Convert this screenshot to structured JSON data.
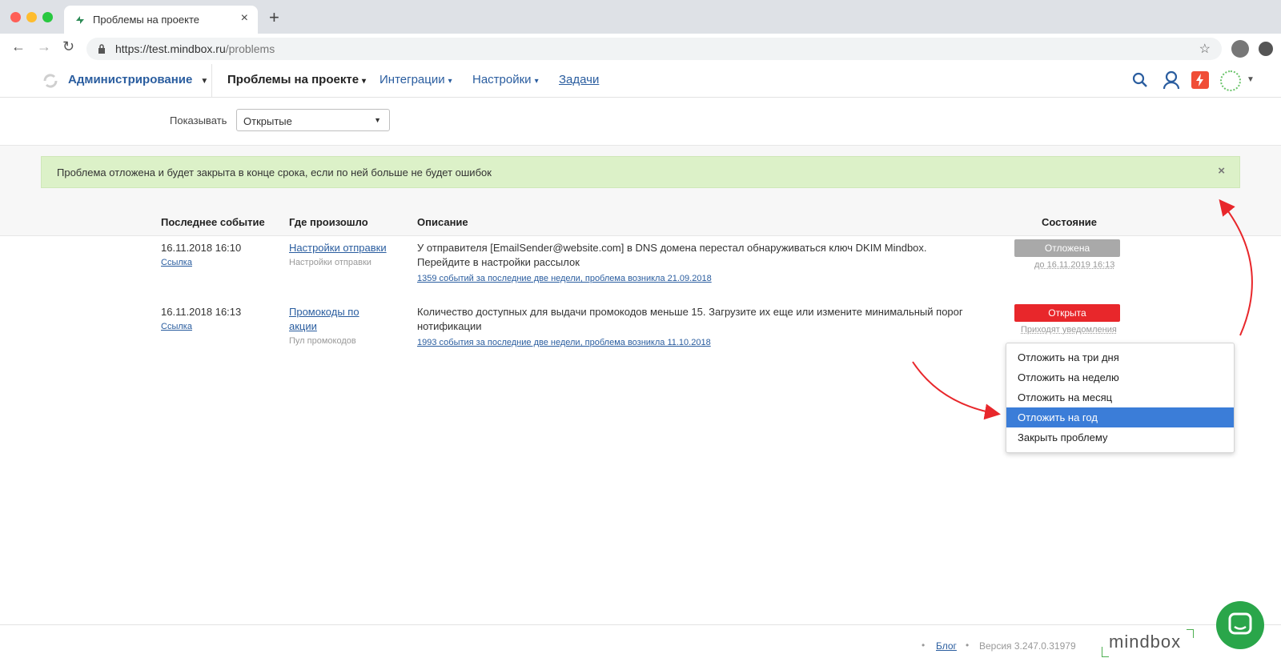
{
  "browser": {
    "tab_title": "Проблемы на проекте",
    "url_host": "https://test.mindbox.ru",
    "url_path": "/problems",
    "new_tab": "+",
    "close": "×"
  },
  "header": {
    "brand": "Администрирование",
    "menu": [
      {
        "label": "Проблемы на проекте"
      },
      {
        "label": "Интеграции"
      },
      {
        "label": "Настройки"
      },
      {
        "label": "Задачи"
      }
    ]
  },
  "filter": {
    "label": "Показывать",
    "value": "Открытые"
  },
  "alert": {
    "text": "Проблема отложена и будет закрыта в конце срока, если по ней больше не будет ошибок",
    "close": "×"
  },
  "table": {
    "columns": [
      "Последнее событие",
      "Где произошло",
      "Описание",
      "Состояние"
    ],
    "rows": [
      {
        "date": "16.11.2018 16:10",
        "date_link": "Ссылка",
        "where_link": "Настройки отправки",
        "where_sub": "Настройки отправки",
        "desc_line1": "У отправителя [EmailSender@website.com] в DNS домена перестал обнаруживаться ключ DKIM Mindbox.",
        "desc_line2": "Перейдите в настройки рассылок",
        "events_link": "1359 событий за последние две недели, проблема возникла 21.09.2018",
        "status": "Отложена",
        "status_sub": "до 16.11.2019 16:13",
        "status_color": "#a9a9a9"
      },
      {
        "date": "16.11.2018 16:13",
        "date_link": "Ссылка",
        "where_link_line1": "Промокоды по",
        "where_link_line2": "акции",
        "where_sub": "Пул промокодов",
        "desc_line1": "Количество доступных для выдачи промокодов меньше 15. Загрузите их еще или измените минимальный порог",
        "desc_line2": "нотификации",
        "events_link": "1993 события за последние две недели, проблема возникла 11.10.2018",
        "status": "Открыта",
        "status_sub": "Приходят уведомления",
        "status_color": "#e8272b"
      }
    ]
  },
  "dropdown": {
    "items": [
      {
        "label": "Отложить на три дня"
      },
      {
        "label": "Отложить на неделю"
      },
      {
        "label": "Отложить на месяц"
      },
      {
        "label": "Отложить на год"
      },
      {
        "label": "Закрыть проблему"
      }
    ],
    "selected_color": "#3b7dd8"
  },
  "footer": {
    "blog": "Блог",
    "version": "Версия 3.247.0.31979",
    "logo": "mindbox"
  },
  "colors": {
    "accent": "#2a5d9f",
    "success_bg": "#dcf1c8",
    "chat": "#2aa64a",
    "arrow": "#e8272b"
  }
}
